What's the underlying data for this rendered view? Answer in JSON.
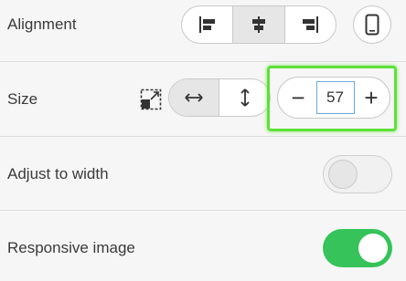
{
  "alignment": {
    "label": "Alignment",
    "options": [
      {
        "icon": "align-left-icon",
        "active": false
      },
      {
        "icon": "align-center-icon",
        "active": true
      },
      {
        "icon": "align-right-icon",
        "active": false
      }
    ],
    "mobile_icon": "mobile-icon"
  },
  "size": {
    "label": "Size",
    "unit_icon": "crop-size-icon",
    "dimension_options": [
      {
        "icon": "horizontal-arrows-icon",
        "active": true
      },
      {
        "icon": "vertical-arrows-icon",
        "active": false
      }
    ],
    "stepper": {
      "minus": "−",
      "plus": "+",
      "value": "57"
    }
  },
  "adjust_to_width": {
    "label": "Adjust to width",
    "enabled": false
  },
  "responsive_image": {
    "label": "Responsive image",
    "enabled": true
  },
  "colors": {
    "toggle_on": "#36c35a",
    "highlight": "#5ee03a",
    "focus": "#6aa8e0"
  }
}
